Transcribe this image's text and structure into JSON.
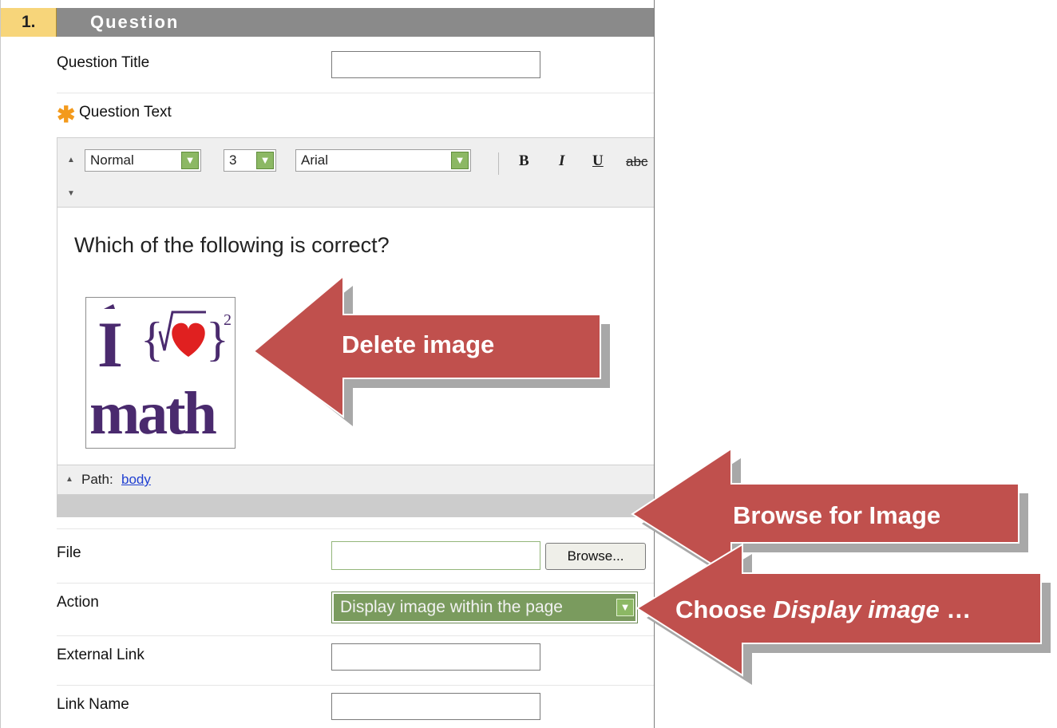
{
  "header": {
    "number": "1.",
    "title": "Question"
  },
  "fields": {
    "question_title_label": "Question Title",
    "question_text_label": "Question Text",
    "file_label": "File",
    "action_label": "Action",
    "external_link_label": "External Link",
    "link_name_label": "Link Name"
  },
  "toolbar": {
    "format_value": "Normal",
    "size_value": "3",
    "font_value": "Arial",
    "bold_label": "B",
    "italic_label": "I",
    "underline_label": "U",
    "strike_label": "abc"
  },
  "editor": {
    "question_text": "Which of the following is correct?",
    "image_text_top": "I",
    "image_text_exponent": "2",
    "image_text_bottom": "math",
    "path_label": "Path:",
    "path_link": "body"
  },
  "file": {
    "browse_label": "Browse..."
  },
  "action": {
    "selected": "Display image within the page"
  },
  "callouts": {
    "delete_image": "Delete image",
    "browse_for_image": "Browse for Image",
    "choose_prefix": "Choose ",
    "choose_italic": "Display image",
    "choose_suffix": " …"
  },
  "colors": {
    "header_bg": "#8a8a8a",
    "header_number_bg": "#f7d57a",
    "required_star": "#f39a1c",
    "callout_fill": "#c0504d",
    "action_select_bg": "#7a9b5e",
    "link": "#1f3fd1"
  }
}
